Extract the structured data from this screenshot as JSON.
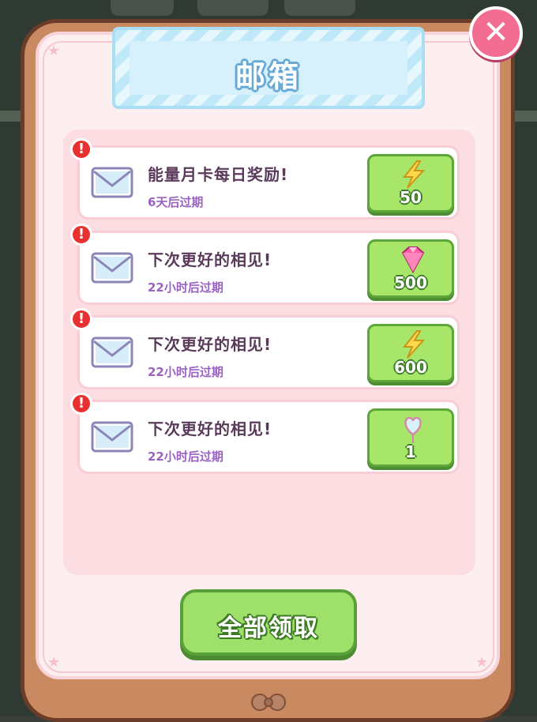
{
  "title": "邮箱",
  "close_icon": "close-icon",
  "mails": [
    {
      "title": "能量月卡每日奖励!",
      "expire": "6天后过期",
      "reward_icon": "lightning-icon",
      "reward_count": "50"
    },
    {
      "title": "下次更好的相见!",
      "expire": "22小时后过期",
      "reward_icon": "gem-icon",
      "reward_count": "500"
    },
    {
      "title": "下次更好的相见!",
      "expire": "22小时后过期",
      "reward_icon": "lightning-icon",
      "reward_count": "600"
    },
    {
      "title": "下次更好的相见!",
      "expire": "22小时后过期",
      "reward_icon": "heart-balloon-icon",
      "reward_count": "1"
    }
  ],
  "claim_all_label": "全部领取",
  "colors": {
    "frame": "#c98a62",
    "panel": "#fdeef0",
    "title_banner": "#bfe8f8",
    "reward_button": "#a8e66a",
    "alert": "#e8302f",
    "close_button": "#f36c92"
  }
}
